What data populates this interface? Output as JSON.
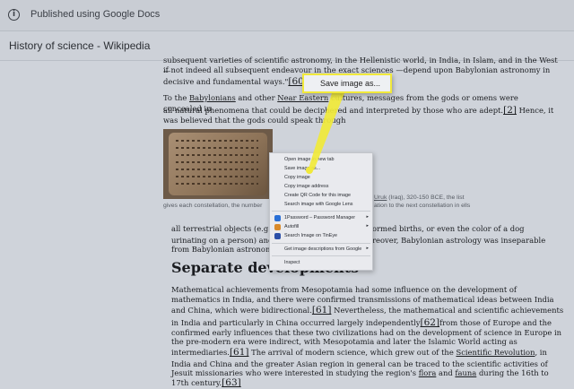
{
  "topbar": {
    "published_text": "Published using Google Docs"
  },
  "doc": {
    "title": "History of science - Wikipedia"
  },
  "paragraphs": {
    "p1_line1": "subsequent varieties of scientific astronomy, in the Hellenistic world, in India, in Islam, and in the West—",
    "p1_line2": "if not indeed all subsequent endeavour in the exact sciences —depend upon Babylonian astronomy in",
    "p1_line3": "decisive and fundamental ways.\"",
    "cite60": "[60]",
    "p2_pre": "To the ",
    "p2_link1": "Babylonians",
    "p2_mid": " and other ",
    "p2_link2": "Near Eastern",
    "p2_rest": " cultures, messages from the gods or omens were concealed in",
    "p2_line2": "all natural phenomena that could be deciphered and interpreted by those who are adept.",
    "cite2": "[2]",
    "p2_line2_end": " Hence, it",
    "p2_line3": "was believed that the gods could speak through"
  },
  "caption": {
    "link": "Uruk",
    "text_right": " (Iraq), 320-150 BCE, the list",
    "line2_left": "gives each constellation, the number",
    "line2_right": "ation to the next constellation in ells"
  },
  "p3": {
    "line1_left": "all terrestrial objects (e.g., ",
    "line1_right": "ormed births, or even the color of a dog",
    "line2_left": "urinating on a person) and c",
    "line2_right": "reover, Babylonian astrology was inseparable",
    "line3": "from Babylonian astronomy."
  },
  "heading": "Separate developments",
  "p4": {
    "l1": "Mathematical achievements from Mesopotamia had some influence on the development of",
    "l2": "mathematics in India, and there were confirmed transmissions of mathematical ideas between India",
    "l3a": "and China, which were bidirectional.",
    "cite61a": "[61]",
    "l3b": " Nevertheless, the mathematical and scientific achievements",
    "l4a": "in India and particularly in China occurred largely independently",
    "cite62": "[62]",
    "l4b": "from those of Europe and the",
    "l5": "confirmed early influences that these two civilizations had on the development of science in Europe in",
    "l6": "the pre-modern era were indirect, with Mesopotamia and later the Islamic World acting as",
    "l7a": "intermediaries.",
    "cite61b": "[61]",
    "l7b": " The arrival of modern science, which grew out of the ",
    "l7link": "Scientific Revolution",
    "l7c": ", in",
    "l8": "India and China and the greater Asian region in general can be traced to the scientific activities of",
    "l9a": "Jesuit missionaries who were interested in studying the region's ",
    "l9link1": "flora",
    "l9b": " and ",
    "l9link2": "fauna",
    "l9c": " during the 16th to",
    "l10a": "17th century.",
    "cite63": "[63]"
  },
  "context_menu": {
    "items": [
      "Open image in new tab",
      "Save image as...",
      "Copy image",
      "Copy image address",
      "Create QR Code for this image",
      "Search image with Google Lens",
      "1Password – Password Manager",
      "Autofill",
      "Search Image on TinEye",
      "Get image descriptions from Google",
      "Inspect"
    ],
    "submenu_arrow": "▸"
  },
  "callout": {
    "label": "Save image as..."
  },
  "colors": {
    "callout_border": "#f1e93a",
    "dim_overlay": "#cfd3da"
  }
}
